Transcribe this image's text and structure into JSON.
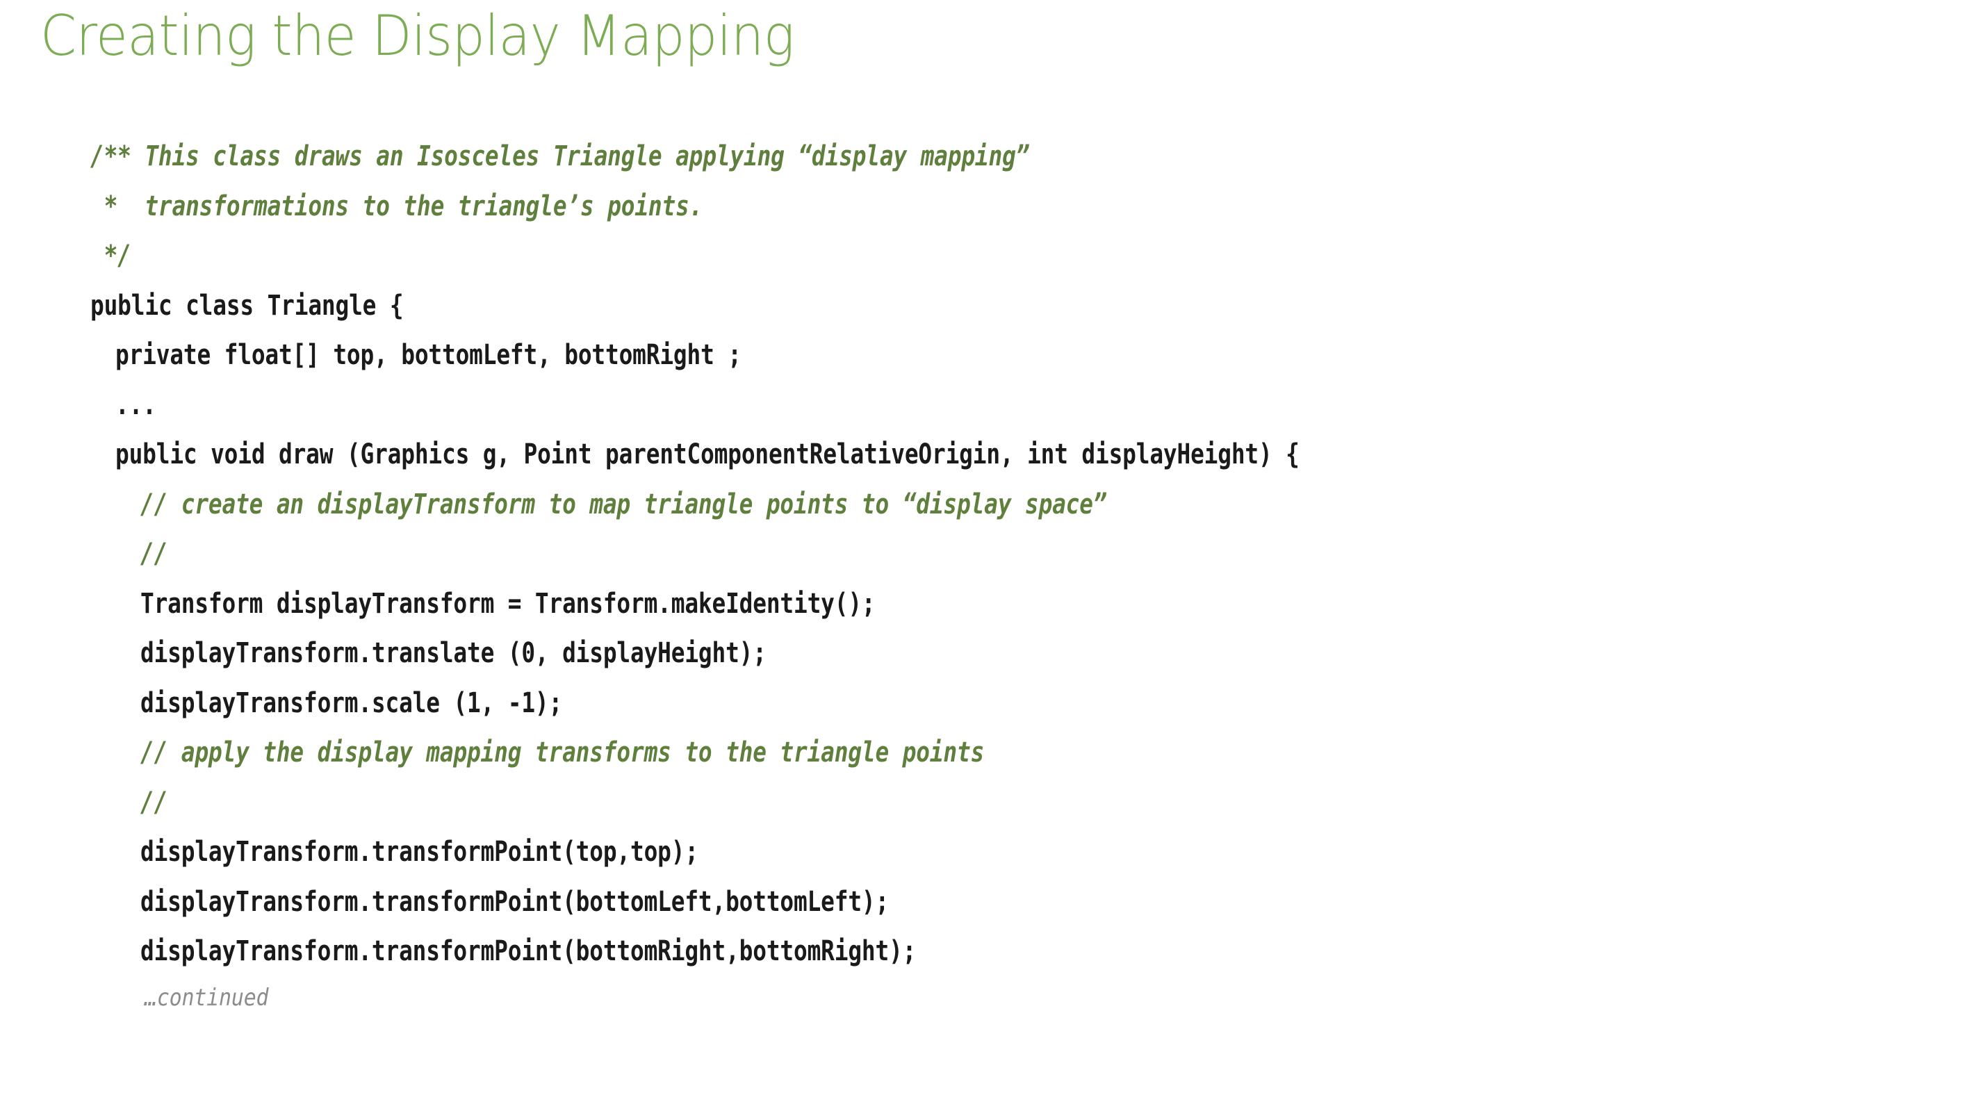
{
  "slide": {
    "title": "Creating the Display Mapping",
    "title_color": "#7CAC54",
    "code_color": "#1a1a1a",
    "comment_color": "#5F7F3C",
    "continued_color": "#8C8C8C",
    "background_color": "#FFFFFF"
  },
  "code": {
    "lines": [
      {
        "id": "l01",
        "text": "/** This class draws an Isosceles Triangle applying “display mapping”",
        "kind": "comment",
        "indent": 0
      },
      {
        "id": "l02",
        "text": " *  transformations to the triangle’s points.",
        "kind": "comment",
        "indent": 0
      },
      {
        "id": "l03",
        "text": " */",
        "kind": "comment",
        "indent": 0
      },
      {
        "id": "l04",
        "text": "public class Triangle {",
        "kind": "code",
        "indent": 0
      },
      {
        "id": "l05",
        "text": "",
        "kind": "blank",
        "indent": 0
      },
      {
        "id": "l06",
        "text": "private float[] top, bottomLeft, bottomRight ;",
        "kind": "code",
        "indent": 1
      },
      {
        "id": "l07",
        "text": "...",
        "kind": "code",
        "indent": 1
      },
      {
        "id": "l08",
        "text": "",
        "kind": "blank",
        "indent": 0
      },
      {
        "id": "l09",
        "text": "public void draw (Graphics g, Point parentComponentRelativeOrigin, int displayHeight) {",
        "kind": "code",
        "indent": 1
      },
      {
        "id": "l10",
        "text": "// create an displayTransform to map triangle points to “display space”",
        "kind": "comment",
        "indent": 2
      },
      {
        "id": "l11",
        "text": "//",
        "kind": "comment",
        "indent": 2
      },
      {
        "id": "l12",
        "text": "Transform displayTransform = Transform.makeIdentity();",
        "kind": "code",
        "indent": 2
      },
      {
        "id": "l13",
        "text": "displayTransform.translate (0, displayHeight);",
        "kind": "code",
        "indent": 2
      },
      {
        "id": "l14",
        "text": "displayTransform.scale (1, -1);",
        "kind": "code",
        "indent": 2
      },
      {
        "id": "l15",
        "text": "",
        "kind": "blank",
        "indent": 0
      },
      {
        "id": "l16",
        "text": "// apply the display mapping transforms to the triangle points",
        "kind": "comment",
        "indent": 2
      },
      {
        "id": "l17",
        "text": "//",
        "kind": "comment",
        "indent": 2
      },
      {
        "id": "l18",
        "text": "displayTransform.transformPoint(top,top);",
        "kind": "code",
        "indent": 2
      },
      {
        "id": "l19",
        "text": "displayTransform.transformPoint(bottomLeft,bottomLeft);",
        "kind": "code",
        "indent": 2
      },
      {
        "id": "l20",
        "text": "displayTransform.transformPoint(bottomRight,bottomRight);",
        "kind": "code",
        "indent": 2
      },
      {
        "id": "l21",
        "text": "…continued",
        "kind": "continued",
        "indent": 2
      }
    ]
  }
}
